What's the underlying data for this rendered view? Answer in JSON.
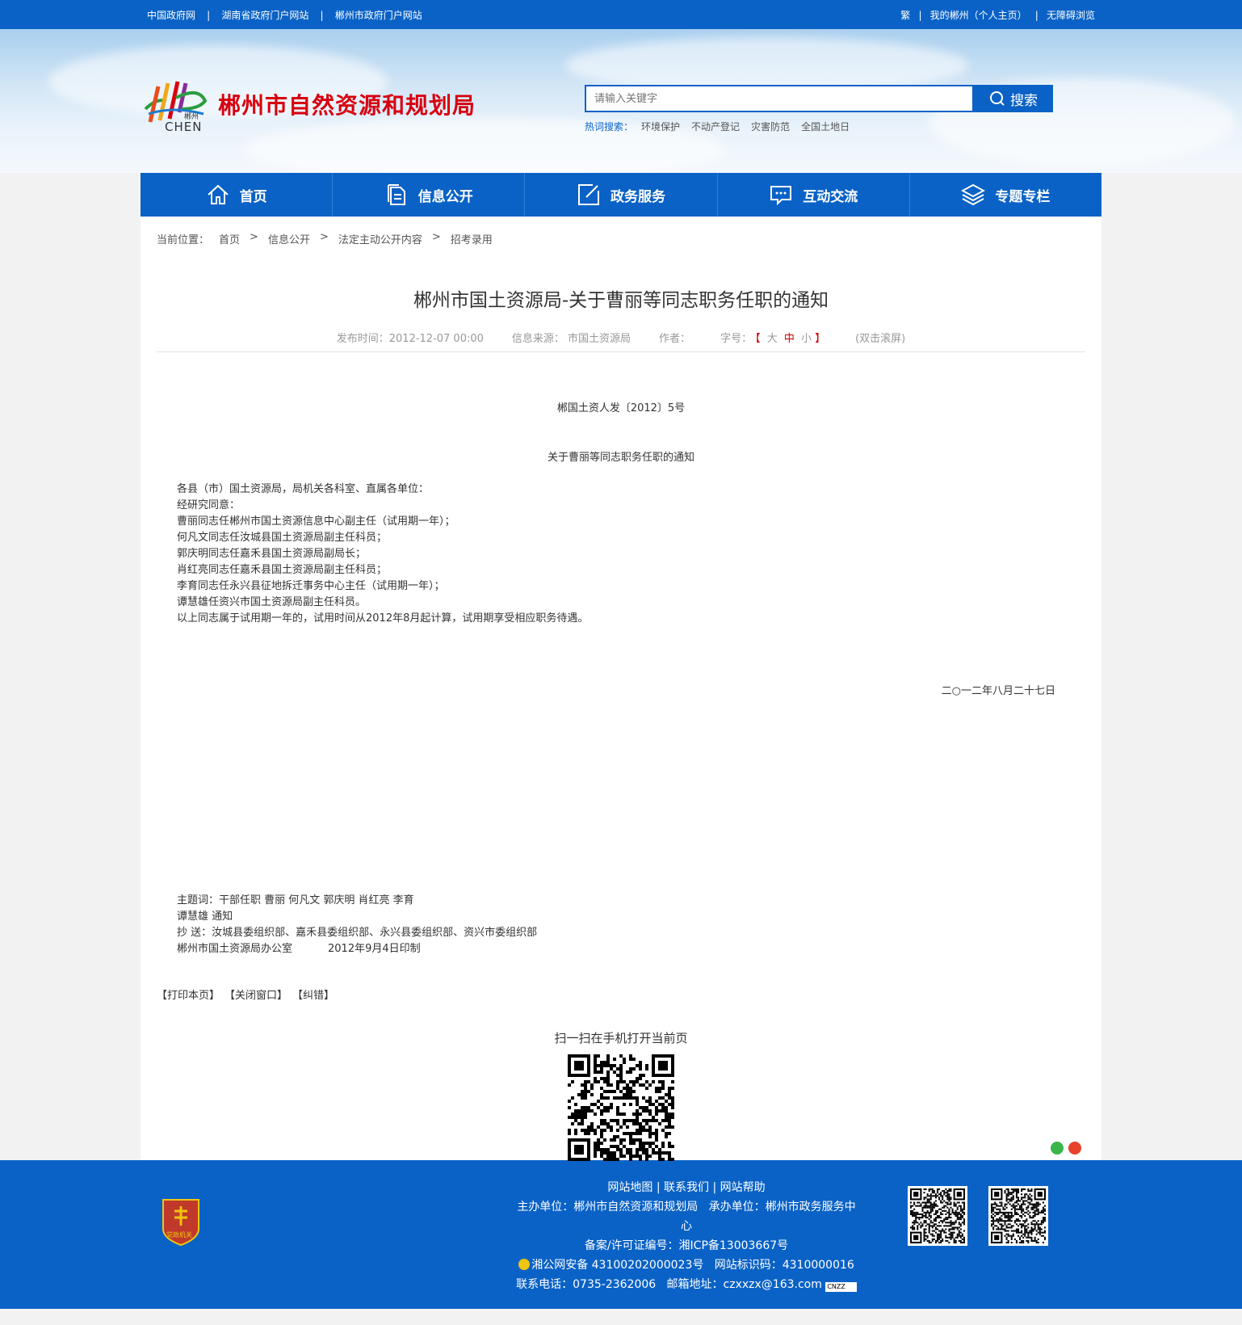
{
  "topbar": {
    "left_links": [
      "中国政府网",
      "湖南省政府门户网站",
      "郴州市政府门户网站"
    ],
    "right_links": [
      "繁",
      "我的郴州（个人主页）",
      "无障碍浏览"
    ]
  },
  "header": {
    "site_name": "郴州市自然资源和规划局",
    "logo_text": "CHEN",
    "logo_small": "郴州",
    "search": {
      "placeholder": "请输入关键字",
      "button_label": "搜索"
    },
    "hot_label": "热词搜索：",
    "hot_words": [
      "环境保护",
      "不动产登记",
      "灾害防范",
      "全国土地日"
    ]
  },
  "nav": {
    "items": [
      {
        "label": "首页",
        "icon": "home-icon"
      },
      {
        "label": "信息公开",
        "icon": "document-icon"
      },
      {
        "label": "政务服务",
        "icon": "edit-icon"
      },
      {
        "label": "互动交流",
        "icon": "chat-icon"
      },
      {
        "label": "专题专栏",
        "icon": "layers-icon"
      }
    ]
  },
  "breadcrumb": {
    "label": "当前位置：",
    "items": [
      "首页",
      "信息公开",
      "法定主动公开内容",
      "招考录用"
    ],
    "separator": ">"
  },
  "article": {
    "title": "郴州市国土资源局-关于曹丽等同志职务任职的通知",
    "publish_time": "发布时间：2012-12-07 00:00",
    "source": "信息来源： 市国土资源局",
    "author": "作者：",
    "font_label": "字号：",
    "font_open": "【",
    "font_large": "大",
    "font_medium": "中",
    "font_small": "小",
    "font_close": "】",
    "dblclick": "(双击滚屏)",
    "doc_no": "郴国土资人发〔2012〕5号",
    "doc_subtitle": "关于曹丽等同志职务任职的通知",
    "body_lines": [
      "各县（市）国土资源局，局机关各科室、直属各单位：",
      "经研究同意：",
      "曹丽同志任郴州市国土资源信息中心副主任（试用期一年）；",
      "何凡文同志任汝城县国土资源局副主任科员；",
      "郭庆明同志任嘉禾县国土资源局副局长；",
      "肖红亮同志任嘉禾县国土资源局副主任科员；",
      "李育同志任永兴县征地拆迁事务中心主任（试用期一年）；",
      "谭慧雄任资兴市国土资源局副主任科员。",
      "以上同志属于试用期一年的，试用时间从2012年8月起计算，试用期享受相应职务待遇。"
    ],
    "date": "二○一二年八月二十七日",
    "foot_line1": "主题词：干部任职  曹丽  何凡文  郭庆明  肖红亮  李育",
    "foot_line2": "谭慧雄  通知",
    "foot_line3": "抄  送：汝城县委组织部、嘉禾县委组织部、永兴县委组织部、资兴市委组织部",
    "foot_line4_a": "郴州市国土资源局办公室",
    "foot_line4_b": "2012年9月4日印制"
  },
  "actions": {
    "print": "【打印本页】",
    "close": "【关闭窗口】",
    "error": "【纠错】"
  },
  "qr": {
    "title": "扫一扫在手机打开当前页"
  },
  "footer": {
    "links": [
      "网站地图",
      "联系我们",
      "网站帮助"
    ],
    "host": "主办单位：郴州市自然资源和规划局",
    "undertaker": "承办单位：郴州市政务服务中心",
    "icp_label": "备案/许可证编号：",
    "icp": "湘ICP备13003667号",
    "police": "湘公网安备 43100202000023号",
    "site_id": "网站标识码：4310000016",
    "phone": "联系电话：0735-2362006",
    "email": "邮箱地址：czxxzx@163.com",
    "emblem_text": "党政机关",
    "cnzz": "CNZZ"
  },
  "colors": {
    "primary": "#0a62c6",
    "site_name": "#d7000f"
  }
}
